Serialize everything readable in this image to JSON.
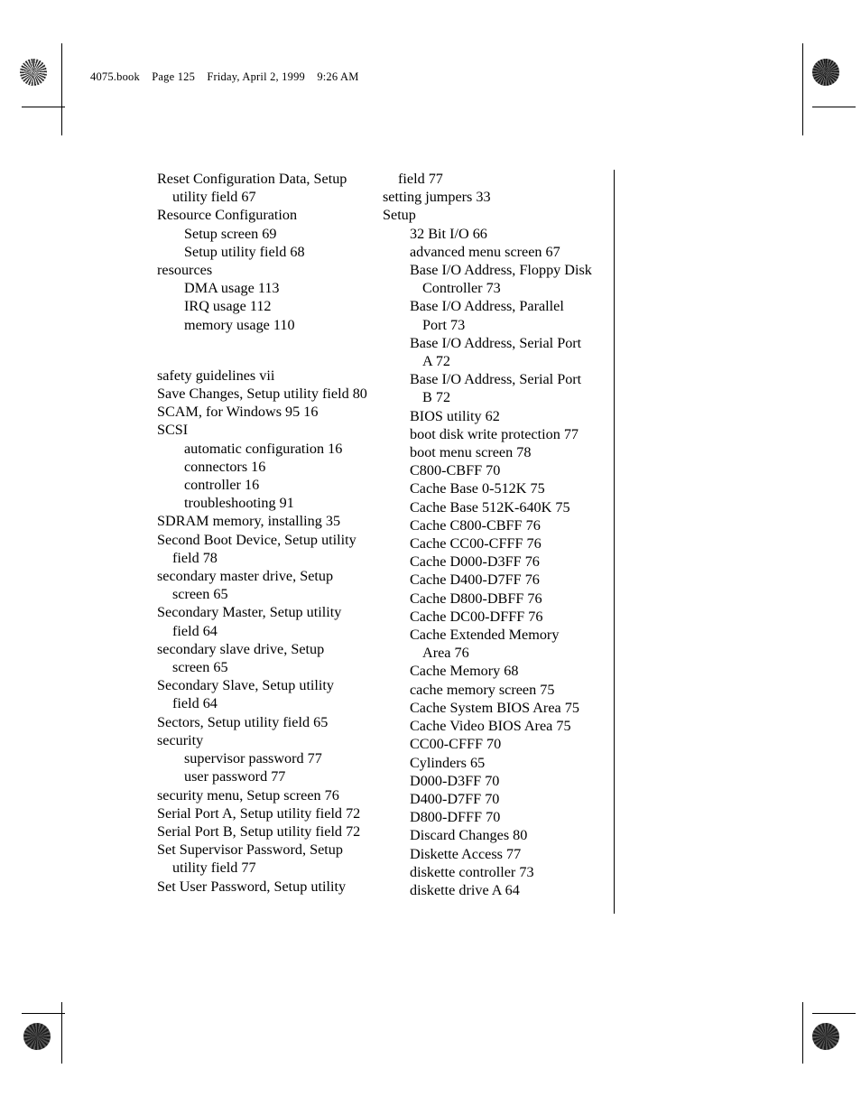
{
  "page": {
    "running_header": {
      "filename": "4075.book",
      "page_label": "Page 125",
      "date": "Friday, April 2, 1999",
      "time": "9:26 AM"
    },
    "marks": {
      "registration_icon": "registration-target-icon",
      "rosette_icon": "halftone-rosette-icon"
    }
  },
  "index": {
    "left_column": [
      {
        "text": "Reset Configuration Data, Setup",
        "level": "lvl1"
      },
      {
        "text": "utility field 67",
        "level": "lvl1-run"
      },
      {
        "text": "Resource Configuration",
        "level": "lvl1"
      },
      {
        "text": "Setup screen 69",
        "level": "lvl2"
      },
      {
        "text": "Setup utility field 68",
        "level": "lvl2"
      },
      {
        "text": "resources",
        "level": "lvl1"
      },
      {
        "text": "DMA usage 113",
        "level": "lvl2"
      },
      {
        "text": "IRQ usage 112",
        "level": "lvl2"
      },
      {
        "text": "memory usage 110",
        "level": "lvl2"
      },
      {
        "text": "",
        "level": "gap"
      },
      {
        "text": "safety guidelines vii",
        "level": "lvl1"
      },
      {
        "text": "Save Changes, Setup utility field 80",
        "level": "lvl1"
      },
      {
        "text": "SCAM, for Windows 95 16",
        "level": "lvl1"
      },
      {
        "text": "SCSI",
        "level": "lvl1"
      },
      {
        "text": "automatic configuration 16",
        "level": "lvl2"
      },
      {
        "text": "connectors 16",
        "level": "lvl2"
      },
      {
        "text": "controller 16",
        "level": "lvl2"
      },
      {
        "text": "troubleshooting 91",
        "level": "lvl2"
      },
      {
        "text": "SDRAM memory, installing 35",
        "level": "lvl1"
      },
      {
        "text": "Second Boot Device, Setup utility",
        "level": "lvl1"
      },
      {
        "text": "field 78",
        "level": "lvl1-run"
      },
      {
        "text": "secondary master drive, Setup",
        "level": "lvl1"
      },
      {
        "text": "screen 65",
        "level": "lvl1-run"
      },
      {
        "text": "Secondary Master, Setup utility",
        "level": "lvl1"
      },
      {
        "text": "field 64",
        "level": "lvl1-run"
      },
      {
        "text": "secondary slave drive, Setup",
        "level": "lvl1"
      },
      {
        "text": "screen 65",
        "level": "lvl1-run"
      },
      {
        "text": "Secondary Slave, Setup utility",
        "level": "lvl1"
      },
      {
        "text": "field 64",
        "level": "lvl1-run"
      },
      {
        "text": "Sectors, Setup utility field 65",
        "level": "lvl1"
      },
      {
        "text": "security",
        "level": "lvl1"
      },
      {
        "text": "supervisor password 77",
        "level": "lvl2"
      },
      {
        "text": "user password 77",
        "level": "lvl2"
      },
      {
        "text": "security menu, Setup screen 76",
        "level": "lvl1"
      },
      {
        "text": "Serial Port A, Setup utility field 72",
        "level": "lvl1"
      },
      {
        "text": "Serial Port B, Setup utility field 72",
        "level": "lvl1"
      },
      {
        "text": "Set Supervisor Password, Setup",
        "level": "lvl1"
      },
      {
        "text": "utility field 77",
        "level": "lvl1-run"
      },
      {
        "text": "Set User Password, Setup utility",
        "level": "lvl1"
      }
    ],
    "right_column": [
      {
        "text": "field 77",
        "level": "lvl1-run"
      },
      {
        "text": "setting jumpers 33",
        "level": "lvl1"
      },
      {
        "text": "Setup",
        "level": "lvl1"
      },
      {
        "text": "32 Bit I/O 66",
        "level": "lvl2"
      },
      {
        "text": "advanced menu screen 67",
        "level": "lvl2"
      },
      {
        "text": "Base I/O Address, Floppy Disk",
        "level": "lvl2"
      },
      {
        "text": "Controller 73",
        "level": "lvl2-run"
      },
      {
        "text": "Base I/O Address, Parallel",
        "level": "lvl2"
      },
      {
        "text": "Port 73",
        "level": "lvl2-run"
      },
      {
        "text": "Base I/O Address, Serial Port",
        "level": "lvl2"
      },
      {
        "text": "A 72",
        "level": "lvl2-run"
      },
      {
        "text": "Base I/O Address, Serial Port",
        "level": "lvl2"
      },
      {
        "text": "B 72",
        "level": "lvl2-run"
      },
      {
        "text": "BIOS utility 62",
        "level": "lvl2"
      },
      {
        "text": "boot disk write protection 77",
        "level": "lvl2"
      },
      {
        "text": "boot menu screen 78",
        "level": "lvl2"
      },
      {
        "text": "C800-CBFF 70",
        "level": "lvl2"
      },
      {
        "text": "Cache Base 0-512K 75",
        "level": "lvl2"
      },
      {
        "text": "Cache Base 512K-640K 75",
        "level": "lvl2"
      },
      {
        "text": "Cache C800-CBFF 76",
        "level": "lvl2"
      },
      {
        "text": "Cache CC00-CFFF 76",
        "level": "lvl2"
      },
      {
        "text": "Cache D000-D3FF 76",
        "level": "lvl2"
      },
      {
        "text": "Cache D400-D7FF 76",
        "level": "lvl2"
      },
      {
        "text": "Cache D800-DBFF 76",
        "level": "lvl2"
      },
      {
        "text": "Cache DC00-DFFF 76",
        "level": "lvl2"
      },
      {
        "text": "Cache Extended Memory",
        "level": "lvl2"
      },
      {
        "text": "Area 76",
        "level": "lvl2-run"
      },
      {
        "text": "Cache Memory 68",
        "level": "lvl2"
      },
      {
        "text": "cache memory screen 75",
        "level": "lvl2"
      },
      {
        "text": "Cache System BIOS Area 75",
        "level": "lvl2"
      },
      {
        "text": "Cache Video BIOS Area 75",
        "level": "lvl2"
      },
      {
        "text": "CC00-CFFF 70",
        "level": "lvl2"
      },
      {
        "text": "Cylinders 65",
        "level": "lvl2"
      },
      {
        "text": "D000-D3FF 70",
        "level": "lvl2"
      },
      {
        "text": "D400-D7FF 70",
        "level": "lvl2"
      },
      {
        "text": "D800-DFFF 70",
        "level": "lvl2"
      },
      {
        "text": "Discard Changes 80",
        "level": "lvl2"
      },
      {
        "text": "Diskette Access 77",
        "level": "lvl2"
      },
      {
        "text": "diskette controller 73",
        "level": "lvl2"
      },
      {
        "text": "diskette drive A 64",
        "level": "lvl2"
      }
    ]
  }
}
